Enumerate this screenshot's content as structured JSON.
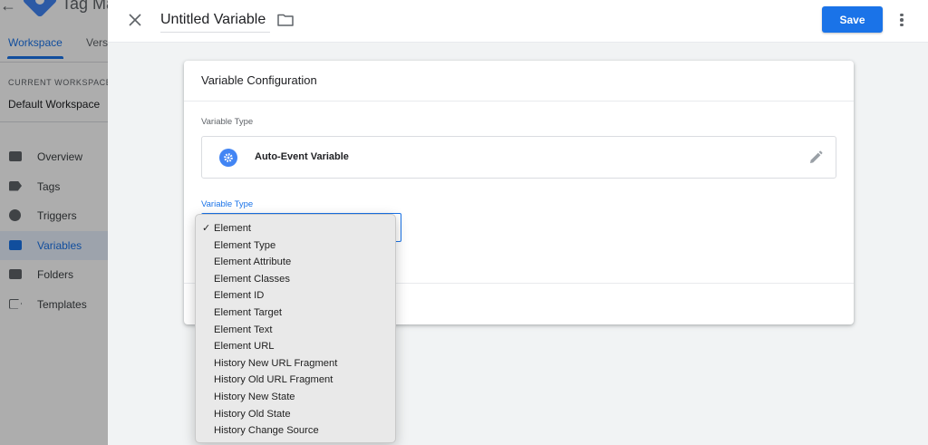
{
  "background": {
    "app_name": "Tag Ma",
    "tabs": [
      {
        "label": "Workspace",
        "active": true
      },
      {
        "label": "Vers",
        "active": false
      }
    ],
    "workspace_section_label": "CURRENT WORKSPACE",
    "workspace_name": "Default Workspace",
    "nav": [
      {
        "label": "Overview",
        "icon": "overview-icon",
        "active": false
      },
      {
        "label": "Tags",
        "icon": "tag-icon",
        "active": false
      },
      {
        "label": "Triggers",
        "icon": "trigger-icon",
        "active": false
      },
      {
        "label": "Variables",
        "icon": "variables-icon",
        "active": true
      },
      {
        "label": "Folders",
        "icon": "folder-icon",
        "active": false
      },
      {
        "label": "Templates",
        "icon": "template-icon",
        "active": false
      }
    ]
  },
  "panel": {
    "title": "Untitled Variable",
    "save_label": "Save"
  },
  "card": {
    "title": "Variable Configuration",
    "variable_type_label": "Variable Type",
    "variable_type_name": "Auto-Event Variable",
    "variable_type_icon": "gear-icon",
    "field_label": "Variable Type"
  },
  "dropdown": {
    "selected": "Element",
    "options": [
      "Element",
      "Element Type",
      "Element Attribute",
      "Element Classes",
      "Element ID",
      "Element Target",
      "Element Text",
      "Element URL",
      "History New URL Fragment",
      "History Old URL Fragment",
      "History New State",
      "History Old State",
      "History Change Source"
    ]
  },
  "colors": {
    "accent": "#1a73e8",
    "icon_blue": "#4285f4",
    "scrim": "rgba(0,0,0,0.32)"
  }
}
